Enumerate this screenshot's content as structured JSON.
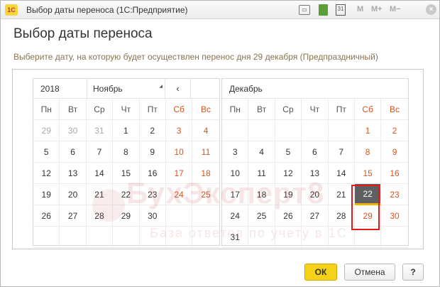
{
  "window": {
    "logo": "1С",
    "title": "Выбор даты переноса  (1С:Предприятие)",
    "toolbar": {
      "print_icon": "print-icon",
      "sheet_icon": "spreadsheet-icon",
      "calendar_icon": "calendar-icon",
      "calendar_day": "31",
      "m": "M",
      "m_plus": "M+",
      "m_minus": "M−",
      "close": "×"
    }
  },
  "form": {
    "title": "Выбор даты переноса",
    "hint": "Выберите дату, на которую будет осуществлен перенос дня 29 декабря (Предпраздничный)"
  },
  "calendar": {
    "left": {
      "year": "2018",
      "month": "Ноябрь",
      "prev": "‹",
      "weekdays": [
        "Пн",
        "Вт",
        "Ср",
        "Чт",
        "Пт",
        "Сб",
        "Вс"
      ],
      "weeks": [
        [
          "29",
          "30",
          "31",
          "1",
          "2",
          "3",
          "4"
        ],
        [
          "5",
          "6",
          "7",
          "8",
          "9",
          "10",
          "11"
        ],
        [
          "12",
          "13",
          "14",
          "15",
          "16",
          "17",
          "18"
        ],
        [
          "19",
          "20",
          "21",
          "22",
          "23",
          "24",
          "25"
        ],
        [
          "26",
          "27",
          "28",
          "29",
          "30",
          "",
          ""
        ],
        [
          "",
          "",
          "",
          "",
          "",
          "",
          ""
        ]
      ]
    },
    "right": {
      "month": "Декабрь",
      "weekdays": [
        "Пн",
        "Вт",
        "Ср",
        "Чт",
        "Пт",
        "Сб",
        "Вс"
      ],
      "weeks": [
        [
          "",
          "",
          "",
          "",
          "",
          "1",
          "2"
        ],
        [
          "3",
          "4",
          "5",
          "6",
          "7",
          "8",
          "9"
        ],
        [
          "10",
          "11",
          "12",
          "13",
          "14",
          "15",
          "16"
        ],
        [
          "17",
          "18",
          "19",
          "20",
          "21",
          "22",
          "23"
        ],
        [
          "24",
          "25",
          "26",
          "27",
          "28",
          "29",
          "30"
        ],
        [
          "31",
          "",
          "",
          "",
          "",
          "",
          ""
        ]
      ],
      "today": "22",
      "selected": "29"
    }
  },
  "watermark": {
    "title": "БухЭксперт8",
    "subtitle": "База ответов по учету в 1С"
  },
  "buttons": {
    "ok": "ОК",
    "cancel": "Отмена",
    "help": "?"
  },
  "colors": {
    "weekend": "#d9531e",
    "ok_button": "#f5d217",
    "today_bg": "#5f5f5f",
    "selection_border": "#e21a1a"
  }
}
